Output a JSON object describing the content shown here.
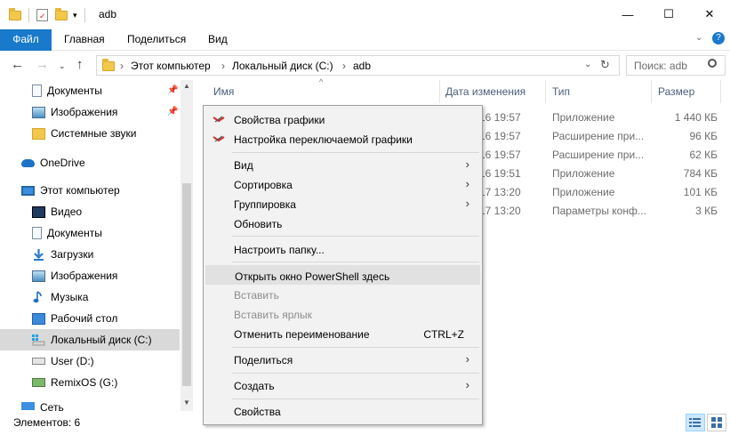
{
  "window": {
    "title": "adb",
    "minimize": "—",
    "maximize": "☐",
    "close": "✕"
  },
  "ribbon": {
    "tabs": [
      "Файл",
      "Главная",
      "Поделиться",
      "Вид"
    ]
  },
  "address": {
    "crumbs": [
      "Этот компьютер",
      "Локальный диск (C:)",
      "adb"
    ],
    "separator": "›",
    "search_placeholder": "Поиск: adb"
  },
  "nav": {
    "items": [
      {
        "label": "Документы",
        "icon": "documents-icon",
        "pinned": true
      },
      {
        "label": "Изображения",
        "icon": "pictures-icon",
        "pinned": true
      },
      {
        "label": "Системные звуки",
        "icon": "folder-icon",
        "pinned": false
      },
      {
        "label": "OneDrive",
        "icon": "onedrive-icon",
        "pinned": false
      },
      {
        "label": "Этот компьютер",
        "icon": "computer-icon",
        "pinned": false
      },
      {
        "label": "Видео",
        "icon": "video-icon",
        "pinned": false
      },
      {
        "label": "Документы",
        "icon": "documents-icon",
        "pinned": false
      },
      {
        "label": "Загрузки",
        "icon": "downloads-icon",
        "pinned": false
      },
      {
        "label": "Изображения",
        "icon": "pictures-icon",
        "pinned": false
      },
      {
        "label": "Музыка",
        "icon": "music-icon",
        "pinned": false
      },
      {
        "label": "Рабочий стол",
        "icon": "desktop-icon",
        "pinned": false
      },
      {
        "label": "Локальный диск (C:)",
        "icon": "local-drive-icon",
        "pinned": false,
        "selected": true
      },
      {
        "label": "User (D:)",
        "icon": "drive-icon",
        "pinned": false
      },
      {
        "label": "RemixOS (G:)",
        "icon": "drive-icon",
        "pinned": false
      },
      {
        "label": "Сеть",
        "icon": "network-icon",
        "pinned": false
      }
    ]
  },
  "filelist": {
    "columns": [
      "Имя",
      "Дата изменения",
      "Тип",
      "Размер"
    ],
    "rows": [
      {
        "date": "16 19:57",
        "type": "Приложение",
        "size": "1 440 КБ"
      },
      {
        "date": "16 19:57",
        "type": "Расширение при...",
        "size": "96 КБ"
      },
      {
        "date": "16 19:57",
        "type": "Расширение при...",
        "size": "62 КБ"
      },
      {
        "date": "16 19:51",
        "type": "Приложение",
        "size": "784 КБ"
      },
      {
        "date": "17 13:20",
        "type": "Приложение",
        "size": "101 КБ"
      },
      {
        "date": "17 13:20",
        "type": "Параметры конф...",
        "size": "3 КБ"
      }
    ]
  },
  "status": {
    "items_count": "Элементов: 6"
  },
  "context_menu": {
    "graphics_properties": "Свойства графики",
    "switchable_graphics": "Настройка переключаемой графики",
    "view": "Вид",
    "sort": "Сортировка",
    "group": "Группировка",
    "refresh": "Обновить",
    "customize_folder": "Настроить папку...",
    "open_powershell": "Открыть окно PowerShell здесь",
    "paste": "Вставить",
    "paste_shortcut": "Вставить ярлык",
    "undo_rename": "Отменить переименование",
    "undo_shortcut": "CTRL+Z",
    "share": "Поделиться",
    "create": "Создать",
    "properties": "Свойства",
    "submenu_arrow": "›"
  },
  "colors": {
    "accent": "#1979ca",
    "highlight": "#e1e1e1",
    "selected_nav": "#d9d9d9"
  }
}
